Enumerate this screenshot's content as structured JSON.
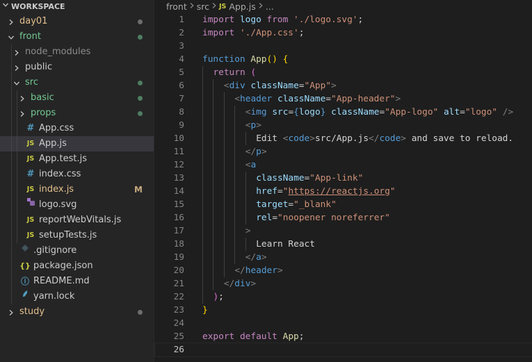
{
  "sidebar": {
    "header": "WORKSPACE",
    "items": [
      {
        "label": "day01",
        "type": "folder",
        "depth": 0,
        "expanded": false,
        "color": "yellow",
        "status": "dot-gray"
      },
      {
        "label": "front",
        "type": "folder",
        "depth": 0,
        "expanded": true,
        "color": "green",
        "status": "dot-green"
      },
      {
        "label": "node_modules",
        "type": "folder",
        "depth": 1,
        "expanded": false,
        "color": "gray",
        "status": ""
      },
      {
        "label": "public",
        "type": "folder",
        "depth": 1,
        "expanded": false,
        "color": "default",
        "status": ""
      },
      {
        "label": "src",
        "type": "folder",
        "depth": 1,
        "expanded": true,
        "color": "green",
        "status": "dot-green"
      },
      {
        "label": "basic",
        "type": "folder",
        "depth": 2,
        "expanded": false,
        "color": "green",
        "status": "dot-green"
      },
      {
        "label": "props",
        "type": "folder",
        "depth": 2,
        "expanded": false,
        "color": "green",
        "status": "dot-green"
      },
      {
        "label": "App.css",
        "type": "css",
        "depth": 2,
        "color": "default",
        "status": ""
      },
      {
        "label": "App.js",
        "type": "js",
        "depth": 2,
        "color": "default",
        "status": "",
        "selected": true
      },
      {
        "label": "App.test.js",
        "type": "js",
        "depth": 2,
        "color": "default",
        "status": ""
      },
      {
        "label": "index.css",
        "type": "css",
        "depth": 2,
        "color": "default",
        "status": ""
      },
      {
        "label": "index.js",
        "type": "js",
        "depth": 2,
        "color": "yellow",
        "status": "M"
      },
      {
        "label": "logo.svg",
        "type": "svg",
        "depth": 2,
        "color": "default",
        "status": ""
      },
      {
        "label": "reportWebVitals.js",
        "type": "js",
        "depth": 2,
        "color": "default",
        "status": ""
      },
      {
        "label": "setupTests.js",
        "type": "js",
        "depth": 2,
        "color": "default",
        "status": ""
      },
      {
        "label": ".gitignore",
        "type": "git",
        "depth": 1,
        "color": "default",
        "status": ""
      },
      {
        "label": "package.json",
        "type": "json",
        "depth": 1,
        "color": "default",
        "status": ""
      },
      {
        "label": "README.md",
        "type": "info",
        "depth": 1,
        "color": "default",
        "status": ""
      },
      {
        "label": "yarn.lock",
        "type": "yarn",
        "depth": 1,
        "color": "default",
        "status": ""
      },
      {
        "label": "study",
        "type": "folder",
        "depth": 0,
        "expanded": false,
        "color": "yellow",
        "status": "dot-gray"
      }
    ]
  },
  "breadcrumb": {
    "parts": [
      "front",
      "src"
    ],
    "file": "App.js",
    "file_icon": "JS",
    "tail": "..."
  },
  "editor": {
    "current_line": 26,
    "lines": [
      {
        "n": 1,
        "indent": 0,
        "tokens": [
          [
            "kw",
            "import"
          ],
          [
            "pl",
            " "
          ],
          [
            "vr",
            "logo"
          ],
          [
            "pl",
            " "
          ],
          [
            "kw",
            "from"
          ],
          [
            "pl",
            " "
          ],
          [
            "str",
            "'./logo.svg'"
          ],
          [
            "pl",
            ";"
          ]
        ]
      },
      {
        "n": 2,
        "indent": 0,
        "tokens": [
          [
            "kw",
            "import"
          ],
          [
            "pl",
            " "
          ],
          [
            "str",
            "'./App.css'"
          ],
          [
            "pl",
            ";"
          ]
        ]
      },
      {
        "n": 3,
        "indent": 0,
        "tokens": []
      },
      {
        "n": 4,
        "indent": 0,
        "tokens": [
          [
            "kwb",
            "function"
          ],
          [
            "pl",
            " "
          ],
          [
            "fn",
            "App"
          ],
          [
            "br",
            "()"
          ],
          [
            "pl",
            " "
          ],
          [
            "br",
            "{"
          ]
        ]
      },
      {
        "n": 5,
        "indent": 1,
        "tokens": [
          [
            "kw",
            "return"
          ],
          [
            "pl",
            " "
          ],
          [
            "br2",
            "("
          ]
        ]
      },
      {
        "n": 6,
        "indent": 2,
        "tokens": [
          [
            "ang",
            "<"
          ],
          [
            "tag",
            "div"
          ],
          [
            "pl",
            " "
          ],
          [
            "attr",
            "className"
          ],
          [
            "pl",
            "="
          ],
          [
            "str",
            "\"App\""
          ],
          [
            "ang",
            ">"
          ]
        ]
      },
      {
        "n": 7,
        "indent": 3,
        "tokens": [
          [
            "ang",
            "<"
          ],
          [
            "tag",
            "header"
          ],
          [
            "pl",
            " "
          ],
          [
            "attr",
            "className"
          ],
          [
            "pl",
            "="
          ],
          [
            "str",
            "\"App-header\""
          ],
          [
            "ang",
            ">"
          ]
        ]
      },
      {
        "n": 8,
        "indent": 4,
        "tokens": [
          [
            "ang",
            "<"
          ],
          [
            "tag",
            "img"
          ],
          [
            "pl",
            " "
          ],
          [
            "attr",
            "src"
          ],
          [
            "pl",
            "="
          ],
          [
            "kwb",
            "{"
          ],
          [
            "vr",
            "logo"
          ],
          [
            "kwb",
            "}"
          ],
          [
            "pl",
            " "
          ],
          [
            "attr",
            "className"
          ],
          [
            "pl",
            "="
          ],
          [
            "str",
            "\"App-logo\""
          ],
          [
            "pl",
            " "
          ],
          [
            "attr",
            "alt"
          ],
          [
            "pl",
            "="
          ],
          [
            "str",
            "\"logo\""
          ],
          [
            "pl",
            " "
          ],
          [
            "ang",
            "/>"
          ]
        ]
      },
      {
        "n": 9,
        "indent": 4,
        "tokens": [
          [
            "ang",
            "<"
          ],
          [
            "tag",
            "p"
          ],
          [
            "ang",
            ">"
          ]
        ]
      },
      {
        "n": 10,
        "indent": 5,
        "tokens": [
          [
            "pl",
            "Edit "
          ],
          [
            "ang",
            "<"
          ],
          [
            "tag",
            "code"
          ],
          [
            "ang",
            ">"
          ],
          [
            "pl",
            "src/App.js"
          ],
          [
            "ang",
            "</"
          ],
          [
            "tag",
            "code"
          ],
          [
            "ang",
            ">"
          ],
          [
            "pl",
            " and save to reload."
          ]
        ]
      },
      {
        "n": 11,
        "indent": 4,
        "tokens": [
          [
            "ang",
            "</"
          ],
          [
            "tag",
            "p"
          ],
          [
            "ang",
            ">"
          ]
        ]
      },
      {
        "n": 12,
        "indent": 4,
        "tokens": [
          [
            "ang",
            "<"
          ],
          [
            "tag",
            "a"
          ]
        ]
      },
      {
        "n": 13,
        "indent": 5,
        "tokens": [
          [
            "attr",
            "className"
          ],
          [
            "pl",
            "="
          ],
          [
            "str",
            "\"App-link\""
          ]
        ]
      },
      {
        "n": 14,
        "indent": 5,
        "tokens": [
          [
            "attr",
            "href"
          ],
          [
            "pl",
            "="
          ],
          [
            "str",
            "\""
          ],
          [
            "link",
            "https://reactjs.org"
          ],
          [
            "str",
            "\""
          ]
        ]
      },
      {
        "n": 15,
        "indent": 5,
        "tokens": [
          [
            "attr",
            "target"
          ],
          [
            "pl",
            "="
          ],
          [
            "str",
            "\"_blank\""
          ]
        ]
      },
      {
        "n": 16,
        "indent": 5,
        "tokens": [
          [
            "attr",
            "rel"
          ],
          [
            "pl",
            "="
          ],
          [
            "str",
            "\"noopener noreferrer\""
          ]
        ]
      },
      {
        "n": 17,
        "indent": 4,
        "tokens": [
          [
            "ang",
            ">"
          ]
        ]
      },
      {
        "n": 18,
        "indent": 5,
        "tokens": [
          [
            "pl",
            "Learn React"
          ]
        ]
      },
      {
        "n": 19,
        "indent": 4,
        "tokens": [
          [
            "ang",
            "</"
          ],
          [
            "tag",
            "a"
          ],
          [
            "ang",
            ">"
          ]
        ]
      },
      {
        "n": 20,
        "indent": 3,
        "tokens": [
          [
            "ang",
            "</"
          ],
          [
            "tag",
            "header"
          ],
          [
            "ang",
            ">"
          ]
        ]
      },
      {
        "n": 21,
        "indent": 2,
        "tokens": [
          [
            "ang",
            "</"
          ],
          [
            "tag",
            "div"
          ],
          [
            "ang",
            ">"
          ]
        ]
      },
      {
        "n": 22,
        "indent": 1,
        "tokens": [
          [
            "br2",
            ")"
          ],
          [
            "pl",
            ";"
          ]
        ]
      },
      {
        "n": 23,
        "indent": 0,
        "tokens": [
          [
            "br",
            "}"
          ]
        ]
      },
      {
        "n": 24,
        "indent": 0,
        "tokens": []
      },
      {
        "n": 25,
        "indent": 0,
        "tokens": [
          [
            "kw",
            "export"
          ],
          [
            "pl",
            " "
          ],
          [
            "kw",
            "default"
          ],
          [
            "pl",
            " "
          ],
          [
            "fn",
            "App"
          ],
          [
            "pl",
            ";"
          ]
        ]
      },
      {
        "n": 26,
        "indent": 0,
        "tokens": []
      }
    ]
  },
  "colors": {
    "sidebar_bg": "#252526",
    "editor_bg": "#1e1e1e",
    "selected_row": "#37373d",
    "git_added": "#73c991",
    "git_modified": "#e2c08d"
  }
}
